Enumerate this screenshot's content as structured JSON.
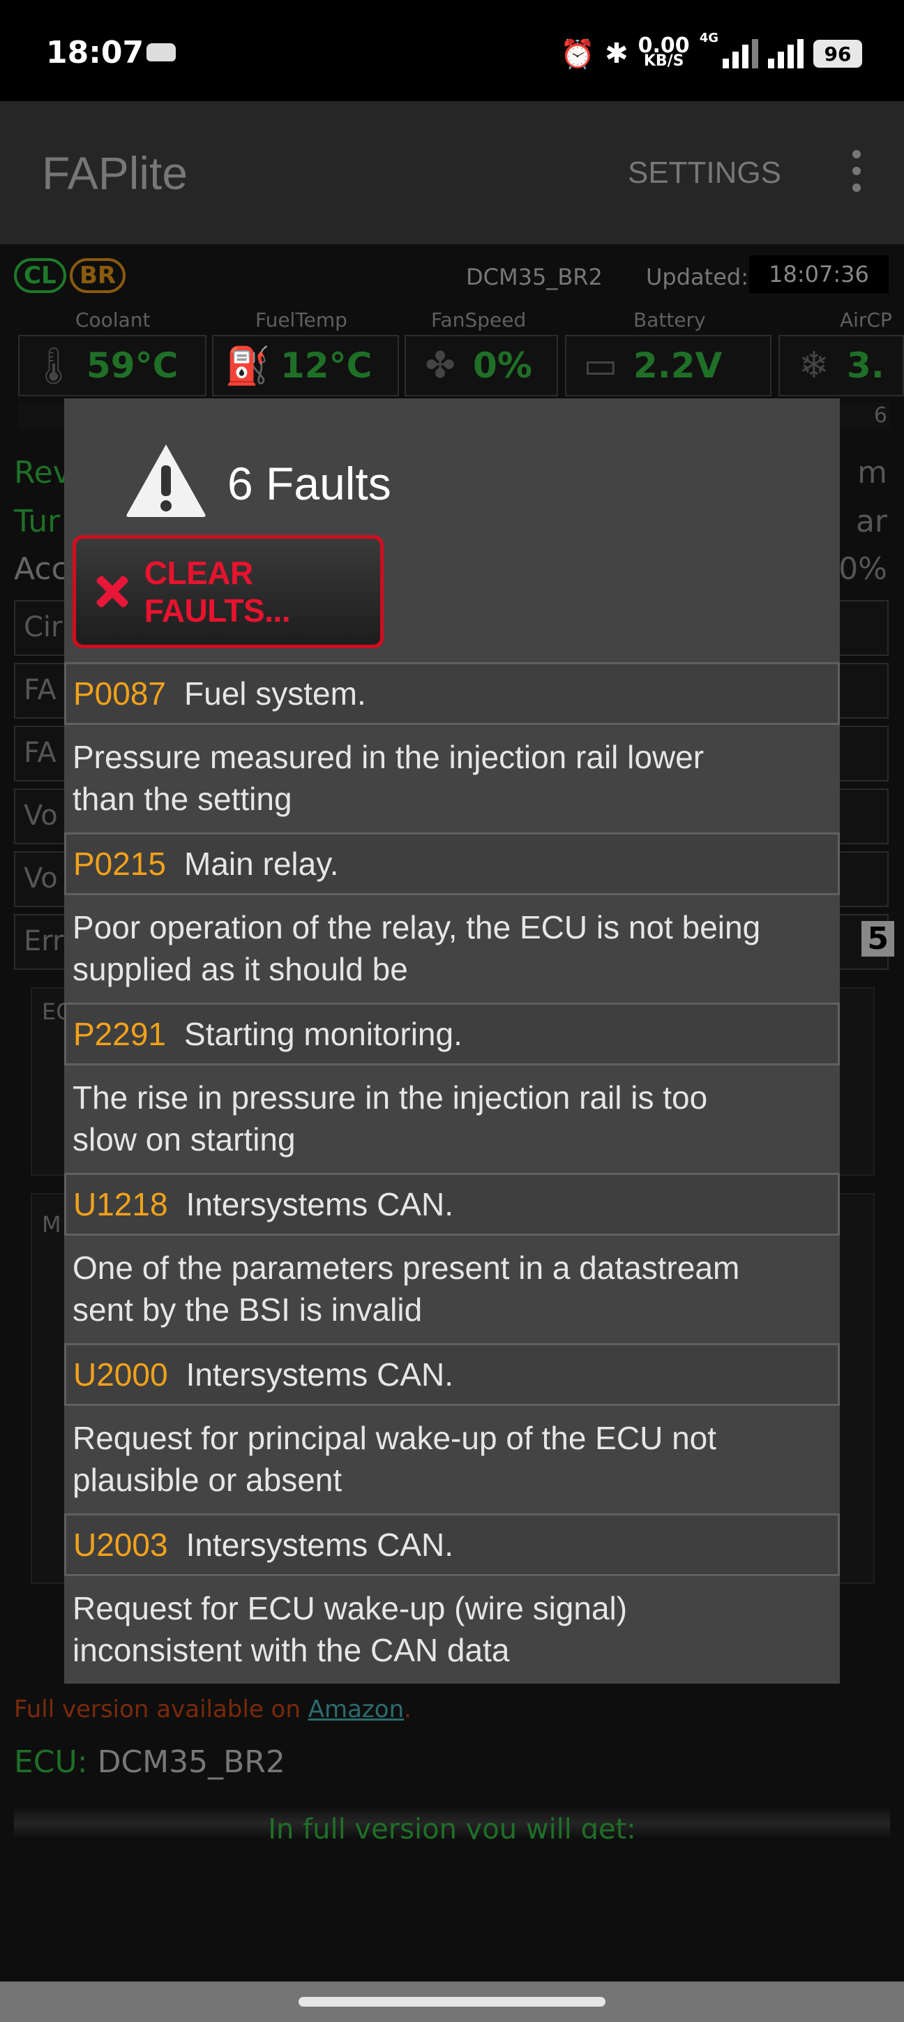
{
  "status_bar": {
    "time": "18:07",
    "speed_value": "0.00",
    "speed_unit": "KB/S",
    "network": "4G",
    "battery": "96"
  },
  "app": {
    "title": "FAPlite",
    "settings_label": "SETTINGS",
    "badges": [
      "CL",
      "BR"
    ],
    "ecu_name": "DCM35_BR2",
    "updated_label": "Updated:",
    "updated_time": "18:07:36",
    "gauge_labels": [
      "Coolant",
      "FuelTemp",
      "FanSpeed",
      "Battery",
      "AirCP"
    ],
    "gauge_values": [
      "59°C",
      "12°C",
      "0%",
      "2.2V",
      "3."
    ],
    "gauge_icons": [
      "thermometer-icon",
      "fuel-pump-icon",
      "fan-icon",
      "battery-icon",
      "snowflake-icon"
    ],
    "left_labels": [
      "Rev",
      "Tur",
      "Acc",
      "Cir",
      "FA",
      "FA",
      "Vo",
      "Vo",
      "Err",
      "EC",
      "M"
    ],
    "right_labels": [
      "6",
      "m",
      "ar",
      "0%",
      "5"
    ],
    "footer_note": "Full version available on ",
    "footer_link": "Amazon",
    "footer_dot": ".",
    "ecu_label": "ECU:",
    "ecu_value": "DCM35_BR2",
    "full_version": "In full version you will get:"
  },
  "dialog": {
    "title": "6 Faults",
    "clear_button": "CLEAR FAULTS...",
    "faults": [
      {
        "code": "P0087",
        "name": "Fuel system.",
        "desc_1": "Pressure measured in the injection rail lower",
        "desc_2": "than the setting"
      },
      {
        "code": "P0215",
        "name": "Main relay.",
        "desc_1": "Poor operation of the relay, the ECU is not being",
        "desc_2": "supplied as it should be"
      },
      {
        "code": "P2291",
        "name": "Starting monitoring.",
        "desc_1": "The rise in pressure in the injection rail is too",
        "desc_2": "slow on starting"
      },
      {
        "code": "U1218",
        "name": "Intersystems CAN.",
        "desc_1": "One of the parameters present in a datastream",
        "desc_2": "sent by the BSI is invalid"
      },
      {
        "code": "U2000",
        "name": "Intersystems CAN.",
        "desc_1": "Request for principal wake-up of the ECU not",
        "desc_2": "plausible or absent"
      },
      {
        "code": "U2003",
        "name": "Intersystems CAN.",
        "desc_1": "Request for ECU wake-up (wire signal)",
        "desc_2": "inconsistent with the CAN data"
      }
    ]
  },
  "colors": {
    "dialog_bg": "#444444",
    "fault_code": "#f2a21a",
    "clear_red": "#e8132e",
    "gauge_green": "#1f6f27"
  }
}
